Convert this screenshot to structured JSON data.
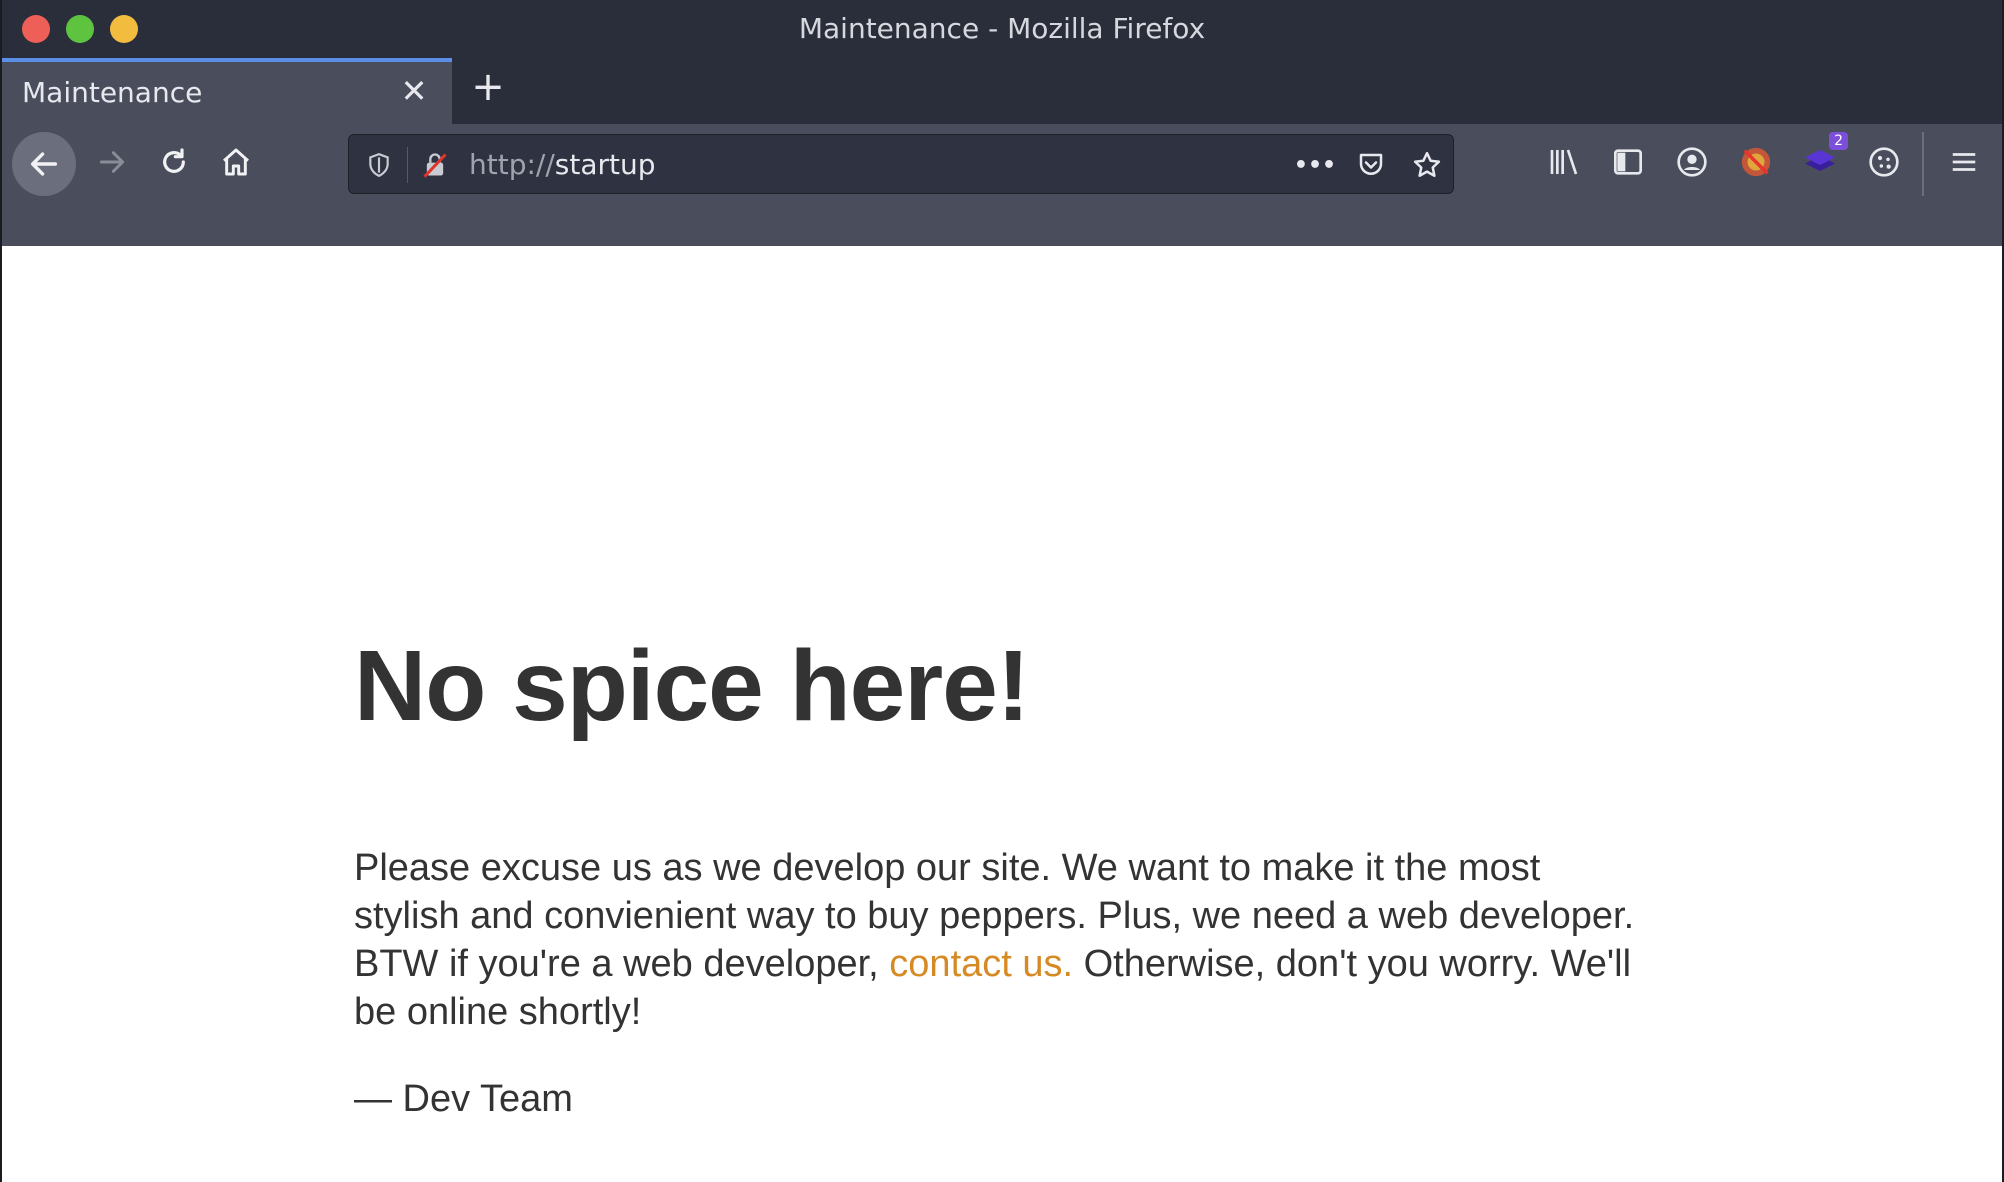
{
  "window": {
    "title": "Maintenance - Mozilla Firefox"
  },
  "tabs": [
    {
      "label": "Maintenance",
      "active": true
    }
  ],
  "tab_close_glyph": "✕",
  "new_tab_glyph": "+",
  "address_bar": {
    "scheme": "http://",
    "host": "startup",
    "more_glyph": "•••"
  },
  "toolbar_icons": [
    "back-icon",
    "forward-icon",
    "reload-icon",
    "home-icon",
    "shield-icon",
    "insecure-lock-icon",
    "more-actions-icon",
    "pocket-icon",
    "bookmark-star-icon",
    "library-icon",
    "sidebar-icon",
    "account-icon",
    "extension-blocked-icon",
    "extension-stack-icon",
    "cookie-icon",
    "hamburger-menu-icon"
  ],
  "extension_badge": "2",
  "colors": {
    "accent_tab": "#5b8ee6",
    "link": "#d68a24",
    "text": "#333333",
    "chrome_dark": "#2a2e3a",
    "chrome_mid": "#4a4e5c"
  },
  "page": {
    "headline": "No spice here!",
    "message_before_link": "Please excuse us as we develop our site. We want to make it the most stylish and convienient way to buy peppers. Plus, we need a web developer. BTW if you're a web developer, ",
    "link_text": "contact us.",
    "message_after_link": " Otherwise, don't you worry. We'll be online shortly!",
    "signature": "— Dev Team"
  }
}
